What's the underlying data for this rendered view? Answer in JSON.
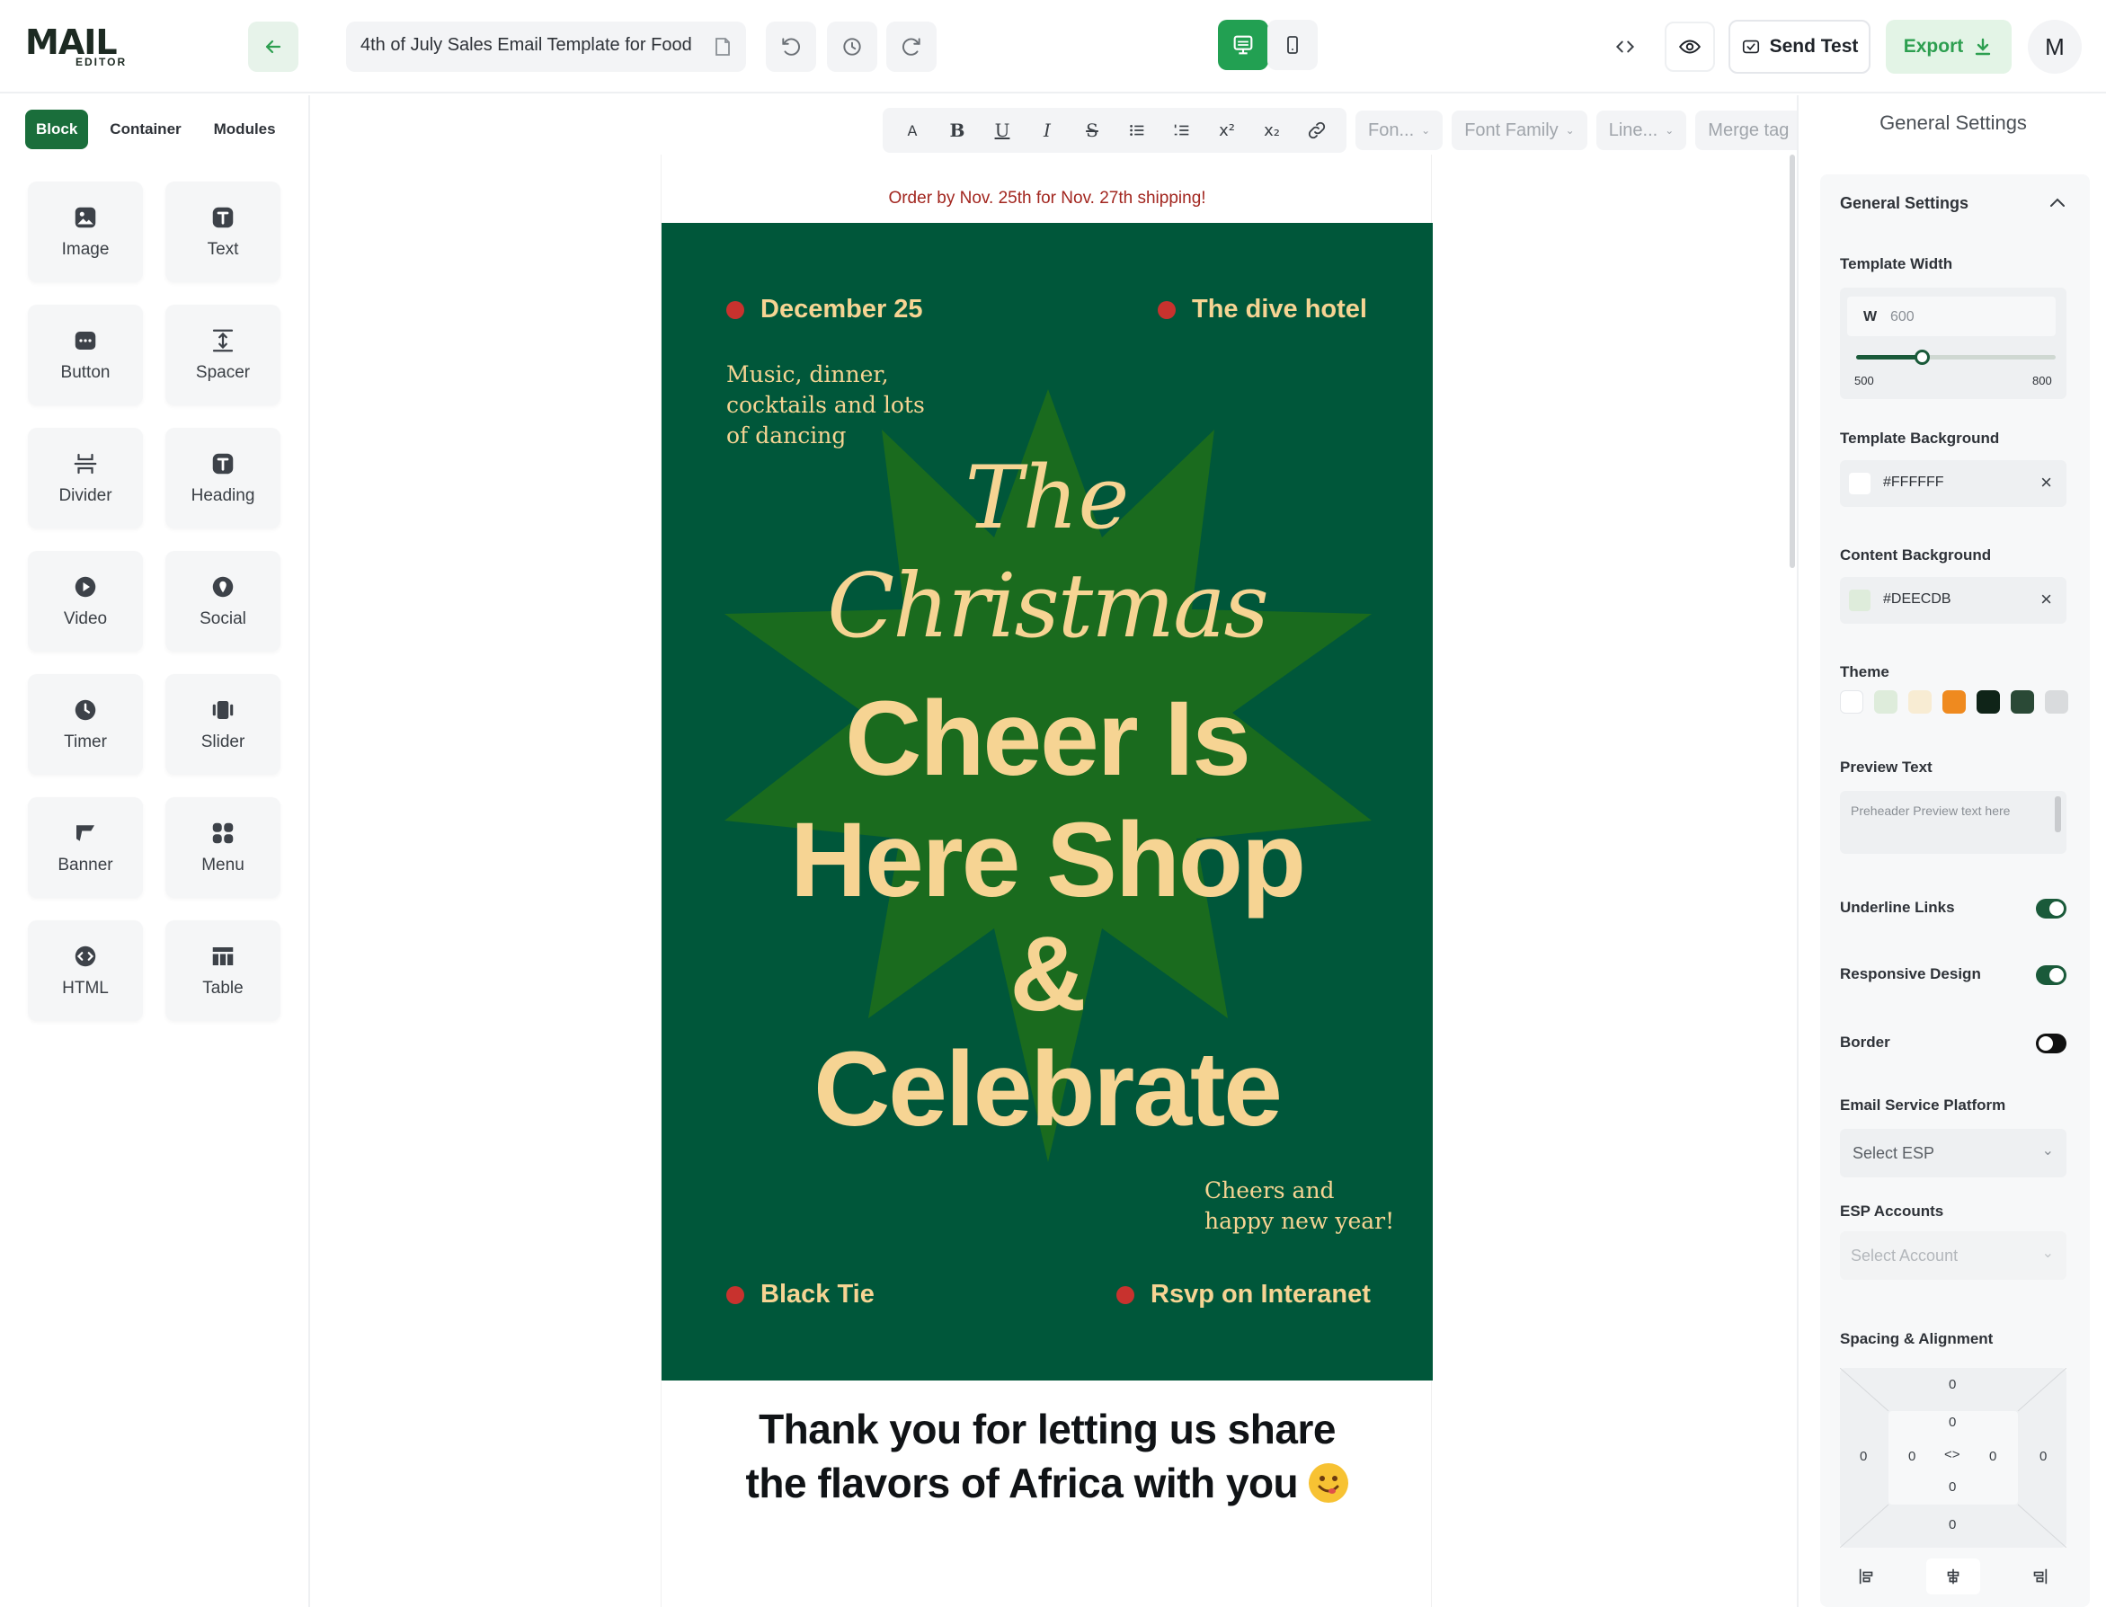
{
  "topbar": {
    "logo_main": "MAIL",
    "logo_sub": "EDITOR",
    "template_title": "4th of July Sales Email Template for Food",
    "send_test_label": "Send Test",
    "export_label": "Export",
    "avatar_initial": "M"
  },
  "left": {
    "tabs": [
      "Block",
      "Container",
      "Modules"
    ],
    "blocks": [
      "Image",
      "Text",
      "Button",
      "Spacer",
      "Divider",
      "Heading",
      "Video",
      "Social",
      "Timer",
      "Slider",
      "Banner",
      "Menu",
      "HTML",
      "Table"
    ]
  },
  "toolbar": {
    "font_size": "Fon...",
    "font_family": "Font Family",
    "line_height": "Line...",
    "merge_tag": "Merge tag"
  },
  "email": {
    "preheader": "Order by Nov. 25th for Nov. 27th shipping!",
    "date": "December 25",
    "venue": "The dive hotel",
    "tagline_1": "Music, dinner,",
    "tagline_2": "cocktails and lots",
    "tagline_3": "of dancing",
    "script_the": "The",
    "script_christmas": "Christmas",
    "headline_1": "Cheer Is",
    "headline_2": "Here Shop",
    "headline_3": "&",
    "headline_4": "Celebrate",
    "closing_1": "Cheers and",
    "closing_2": "happy new year!",
    "dress": "Black Tie",
    "rsvp": "Rsvp on Interanet",
    "thanks_1": "Thank you for letting us share",
    "thanks_2": "the flavors of Africa with you"
  },
  "settings": {
    "title": "General Settings",
    "section_title": "General Settings",
    "template_width_label": "Template Width",
    "width_prefix": "W",
    "width_value": "600",
    "width_min": "500",
    "width_max": "800",
    "width_fraction": 0.33,
    "template_bg_label": "Template Background",
    "template_bg_value": "#FFFFFF",
    "content_bg_label": "Content Background",
    "content_bg_value": "#DEECDB",
    "theme_label": "Theme",
    "theme_colors": [
      "#ffffff",
      "#deecdb",
      "#f8ecd3",
      "#ef8a1f",
      "#0f2418",
      "#2a4936",
      "#d9dbdd"
    ],
    "preview_text_label": "Preview Text",
    "preview_text_placeholder": "Preheader Preview text here",
    "underline_links_label": "Underline Links",
    "responsive_label": "Responsive Design",
    "border_label": "Border",
    "esp_label": "Email Service Platform",
    "esp_placeholder": "Select ESP",
    "esp_accounts_label": "ESP Accounts",
    "esp_accounts_placeholder": "Select Account",
    "spacing_label": "Spacing & Alignment",
    "spacing_values": [
      "0",
      "0",
      "0",
      "0",
      "0",
      "0",
      "0",
      "0",
      "0"
    ]
  },
  "colors": {
    "brand_green": "#1a6e3b",
    "hero_green": "#00573a",
    "star_green": "#1a6b1e",
    "gold": "#f6d493",
    "accent_red": "#c8322e"
  }
}
